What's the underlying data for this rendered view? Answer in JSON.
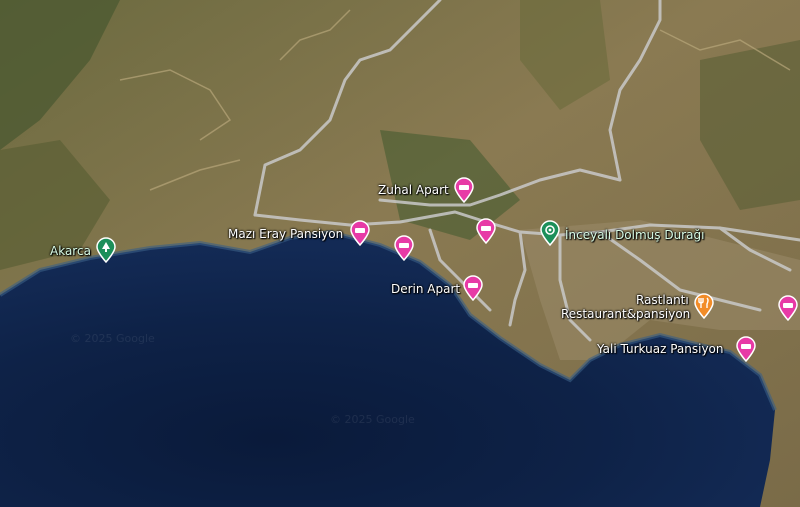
{
  "map_type": "satellite",
  "colors": {
    "lodging": "#e73aa6",
    "restaurant": "#f28c28",
    "transit": "#1c8f5a",
    "park": "#1c8f5a"
  },
  "places": [
    {
      "id": "akarca",
      "name": "Akarca",
      "category": "park",
      "icon": "park-icon"
    },
    {
      "id": "mazi-eray",
      "name": "Mazı Eray Pansiyon",
      "category": "lodging",
      "icon": "bed-icon"
    },
    {
      "id": "zuhal",
      "name": "Zuhal Apart",
      "category": "lodging",
      "icon": "bed-icon"
    },
    {
      "id": "lodging-unlabeled-1",
      "name": "",
      "category": "lodging",
      "icon": "bed-icon"
    },
    {
      "id": "lodging-unlabeled-2",
      "name": "",
      "category": "lodging",
      "icon": "bed-icon"
    },
    {
      "id": "derin",
      "name": "Derin Apart",
      "category": "lodging",
      "icon": "bed-icon"
    },
    {
      "id": "inceyali",
      "name": "İnceyalı Dolmuş Durağı",
      "category": "transit",
      "icon": "bus-stop-icon"
    },
    {
      "id": "rastlanti",
      "name_line1": "Rastlantı",
      "name_line2": "Restaurant&pansiyon",
      "category": "restaurant",
      "icon": "fork-knife-icon"
    },
    {
      "id": "yali-turkuaz",
      "name": "Yali Turkuaz Pansiyon",
      "category": "lodging",
      "icon": "bed-icon"
    },
    {
      "id": "lodging-edge",
      "name": "",
      "category": "lodging",
      "icon": "bed-icon"
    }
  ],
  "watermarks": [
    "© 2025 Google",
    "© 2025 Google"
  ]
}
